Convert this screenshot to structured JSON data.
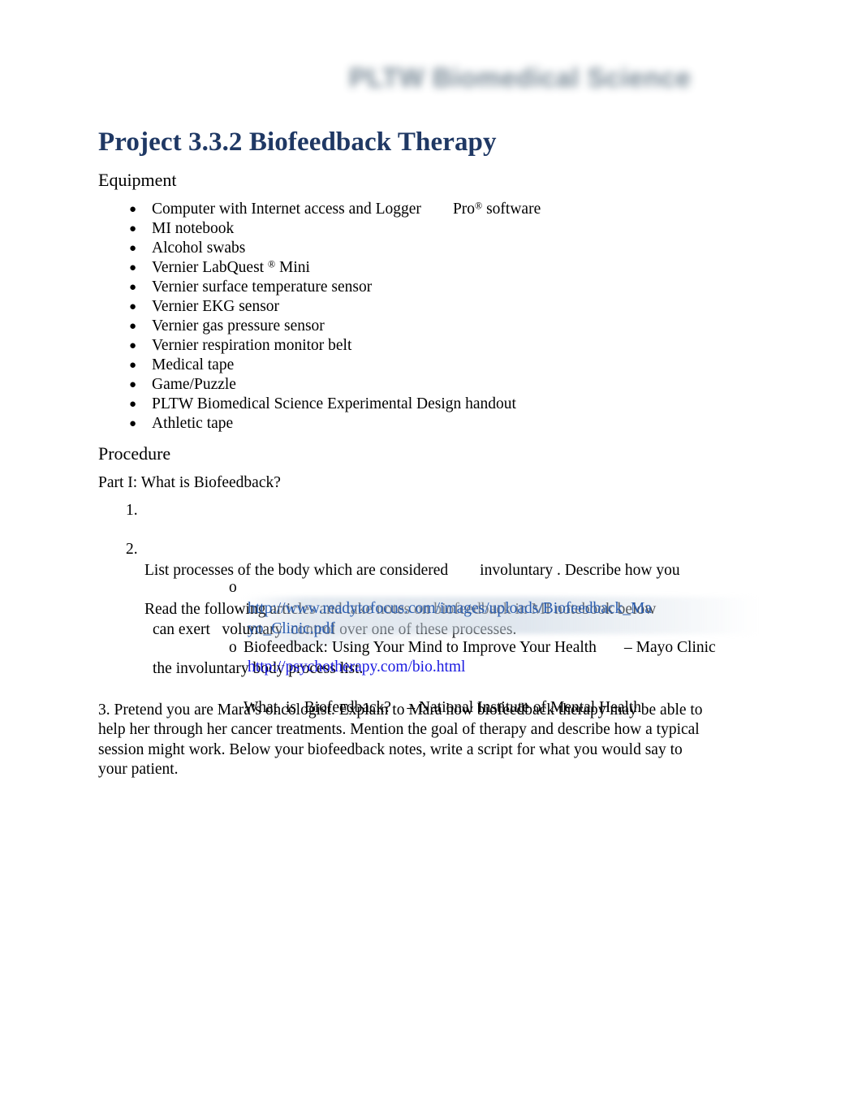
{
  "document": {
    "header_watermark": "PLTW Biomedical Science",
    "title": "Project 3.3.2 Biofeedback Therapy",
    "title_color": "#1f3864",
    "background_color": "#ffffff"
  },
  "equipment": {
    "heading": "Equipment",
    "bullet_glyph": "●",
    "items": [
      {
        "prefix": "Computer with Internet access and Logger",
        "gap": "        ",
        "suffix_before_reg": "Pro",
        "reg": "®",
        "suffix_after_reg": " software"
      },
      {
        "prefix": "MI notebook",
        "gap": "",
        "suffix_before_reg": "",
        "reg": "",
        "suffix_after_reg": ""
      },
      {
        "prefix": "Alcohol swabs",
        "gap": "",
        "suffix_before_reg": "",
        "reg": "",
        "suffix_after_reg": ""
      },
      {
        "prefix": "Vernier LabQuest ",
        "gap": " ",
        "suffix_before_reg": "",
        "reg": "®",
        "suffix_after_reg": " Mini"
      },
      {
        "prefix": "Vernier surface temperature sensor",
        "gap": "",
        "suffix_before_reg": "",
        "reg": "",
        "suffix_after_reg": ""
      },
      {
        "prefix": "Vernier EKG sensor",
        "gap": "",
        "suffix_before_reg": "",
        "reg": "",
        "suffix_after_reg": ""
      },
      {
        "prefix": "Vernier gas pressure sensor",
        "gap": "",
        "suffix_before_reg": "",
        "reg": "",
        "suffix_after_reg": ""
      },
      {
        "prefix": "Vernier respiration monitor belt",
        "gap": "",
        "suffix_before_reg": "",
        "reg": "",
        "suffix_after_reg": ""
      },
      {
        "prefix": "Medical tape",
        "gap": "",
        "suffix_before_reg": "",
        "reg": "",
        "suffix_after_reg": ""
      },
      {
        "prefix": "Game/Puzzle",
        "gap": "",
        "suffix_before_reg": "",
        "reg": "",
        "suffix_after_reg": ""
      },
      {
        "prefix": "PLTW Biomedical Science Experimental Design handout",
        "gap": "",
        "suffix_before_reg": "",
        "reg": "",
        "suffix_after_reg": ""
      },
      {
        "prefix": "Athletic tape",
        "gap": "",
        "suffix_before_reg": "",
        "reg": "",
        "suffix_after_reg": ""
      }
    ]
  },
  "procedure": {
    "heading": "Procedure",
    "part_label": "Part I: What is Biofeedback?",
    "item1": {
      "number": "1.",
      "line1": "List processes of the body which are considered        involuntary . Describe how you",
      "line2": "can exert   voluntary  control over one of these processes."
    },
    "item2": {
      "number": "2.",
      "line1": "Read the following articles and take notes on biofeedback in MI notebook below",
      "line2": "the involuntary body process list."
    },
    "sub_items": [
      {
        "bullet": "o",
        "text": "Biofeedback: Using Your Mind to Improve Your Health       – Mayo Clinic",
        "url": "http://www.readytofocus.com/images/uploads/Biofeedback_Ma\nyo_Clinic.pdf",
        "url_color": "#2a5db0"
      },
      {
        "bullet": "o",
        "text": "What  is  Biofeedback?    – National Institute of Mental Health",
        "url": "http://psychotherapy.com/bio.html",
        "url_color": "#1a1ae0"
      }
    ],
    "item3": {
      "text": "3. Pretend you are Mara’s oncologist. Explain to Mara how biofeedback therapy may be able to help her through her cancer treatments. Mention the goal of therapy and describe how a typical session might work. Below your biofeedback notes, write a script for what you would say to your patient."
    }
  }
}
